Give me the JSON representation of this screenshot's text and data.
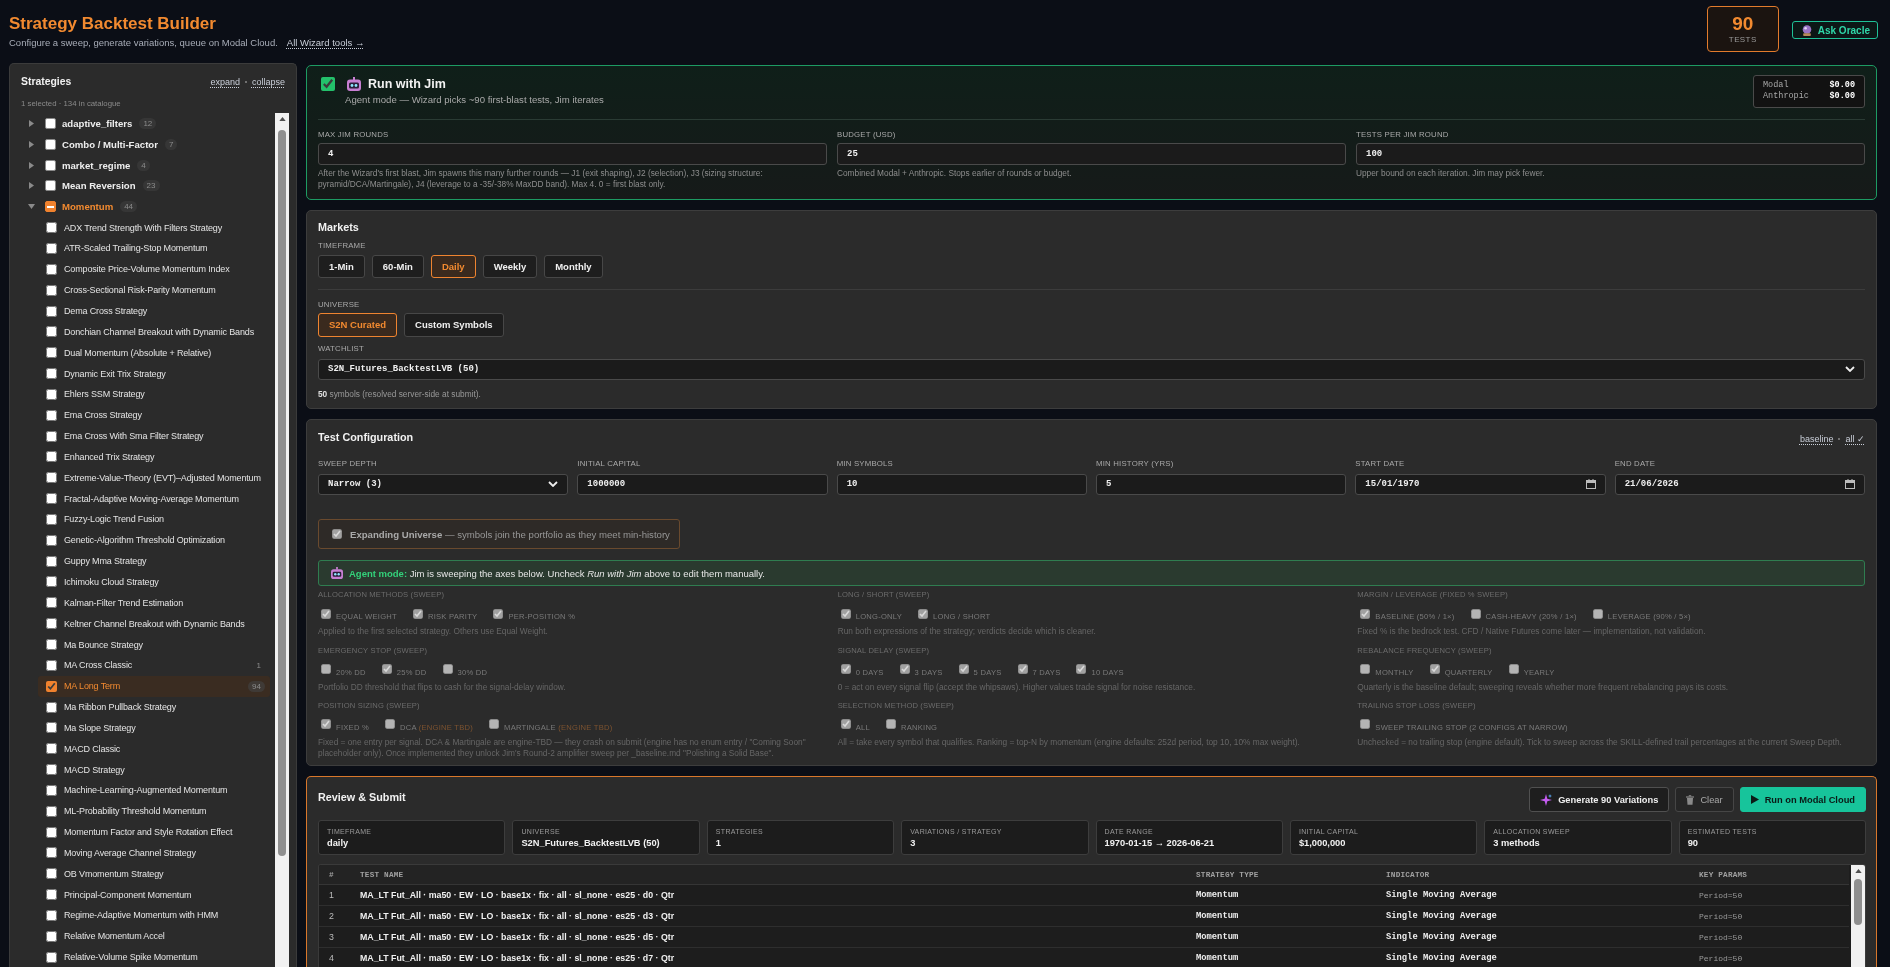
{
  "header": {
    "title": "Strategy Backtest Builder",
    "subtitle": "Configure a sweep, generate variations, queue on Modal Cloud.",
    "link": "All Wizard tools →",
    "tests_count": "90",
    "tests_label": "TESTS",
    "oracle_button": "Ask Oracle"
  },
  "sidebar": {
    "title": "Strategies",
    "actions": [
      "expand",
      "collapse"
    ],
    "summary": "1 selected · 134 in catalogue",
    "categories": [
      {
        "label": "adaptive_filters",
        "count": "12",
        "expanded": false,
        "checked": false,
        "indeterminate": false
      },
      {
        "label": "Combo / Multi-Factor",
        "count": "7",
        "expanded": false,
        "checked": false,
        "indeterminate": false
      },
      {
        "label": "market_regime",
        "count": "4",
        "expanded": false,
        "checked": false,
        "indeterminate": false
      },
      {
        "label": "Mean Reversion",
        "count": "23",
        "expanded": false,
        "checked": false,
        "indeterminate": false
      },
      {
        "label": "Momentum",
        "count": "44",
        "expanded": true,
        "checked": true,
        "indeterminate": true,
        "children": [
          {
            "label": "ADX Trend Strength With Filters Strategy",
            "checked": false,
            "selected": false
          },
          {
            "label": "ATR-Scaled Trailing-Stop Momentum",
            "checked": false,
            "selected": false
          },
          {
            "label": "Composite Price-Volume Momentum Index",
            "checked": false,
            "selected": false
          },
          {
            "label": "Cross-Sectional Risk-Parity Momentum",
            "checked": false,
            "selected": false
          },
          {
            "label": "Dema Cross Strategy",
            "checked": false,
            "selected": false
          },
          {
            "label": "Donchian Channel Breakout with Dynamic Bands",
            "checked": false,
            "selected": false
          },
          {
            "label": "Dual Momentum (Absolute + Relative)",
            "checked": false,
            "selected": false
          },
          {
            "label": "Dynamic Exit Trix Strategy",
            "checked": false,
            "selected": false
          },
          {
            "label": "Ehlers SSM Strategy",
            "checked": false,
            "selected": false
          },
          {
            "label": "Ema Cross Strategy",
            "checked": false,
            "selected": false
          },
          {
            "label": "Ema Cross With Sma Filter Strategy",
            "checked": false,
            "selected": false
          },
          {
            "label": "Enhanced Trix Strategy",
            "checked": false,
            "selected": false
          },
          {
            "label": "Extreme-Value-Theory (EVT)–Adjusted Momentum",
            "checked": false,
            "selected": false
          },
          {
            "label": "Fractal-Adaptive Moving-Average Momentum",
            "checked": false,
            "selected": false
          },
          {
            "label": "Fuzzy-Logic Trend Fusion",
            "checked": false,
            "selected": false
          },
          {
            "label": "Genetic-Algorithm Threshold Optimization",
            "checked": false,
            "selected": false
          },
          {
            "label": "Guppy Mma Strategy",
            "checked": false,
            "selected": false
          },
          {
            "label": "Ichimoku Cloud Strategy",
            "checked": false,
            "selected": false
          },
          {
            "label": "Kalman-Filter Trend Estimation",
            "checked": false,
            "selected": false
          },
          {
            "label": "Keltner Channel Breakout with Dynamic Bands",
            "checked": false,
            "selected": false
          },
          {
            "label": "Ma Bounce Strategy",
            "checked": false,
            "selected": false
          },
          {
            "label": "MA Cross Classic",
            "count": "1",
            "checked": false,
            "selected": false
          },
          {
            "label": "MA Long Term",
            "count": "94",
            "checked": true,
            "selected": true
          },
          {
            "label": "Ma Ribbon Pullback Strategy",
            "checked": false,
            "selected": false
          },
          {
            "label": "Ma Slope Strategy",
            "checked": false,
            "selected": false
          },
          {
            "label": "MACD Classic",
            "checked": false,
            "selected": false
          },
          {
            "label": "MACD Strategy",
            "checked": false,
            "selected": false
          },
          {
            "label": "Machine-Learning-Augmented Momentum",
            "checked": false,
            "selected": false
          },
          {
            "label": "ML-Probability Threshold Momentum",
            "checked": false,
            "selected": false
          },
          {
            "label": "Momentum Factor and Style Rotation Effect",
            "checked": false,
            "selected": false
          },
          {
            "label": "Moving Average Channel Strategy",
            "checked": false,
            "selected": false
          },
          {
            "label": "OB Vmomentum Strategy",
            "checked": false,
            "selected": false
          },
          {
            "label": "Principal-Component Momentum",
            "checked": false,
            "selected": false
          },
          {
            "label": "Regime-Adaptive Momentum with HMM",
            "checked": false,
            "selected": false
          },
          {
            "label": "Relative Momentum Accel",
            "checked": false,
            "selected": false
          },
          {
            "label": "Relative-Volume Spike Momentum",
            "checked": false,
            "selected": false
          }
        ]
      }
    ]
  },
  "agent": {
    "checked": true,
    "title": "Run with Jim",
    "subtitle": "Agent mode — Wizard picks ~90 first-blast tests, Jim iterates",
    "costs": [
      {
        "name": "Modal",
        "value": "$0.00"
      },
      {
        "name": "Anthropic",
        "value": "$0.00"
      }
    ],
    "fields": [
      {
        "label": "MAX JIM ROUNDS",
        "value": "4",
        "hint": "After the Wizard's first blast, Jim spawns this many further rounds — J1 (exit shaping), J2 (selection), J3 (sizing structure: pyramid/DCA/Martingale), J4 (leverage to a -35/-38% MaxDD band). Max 4. 0 = first blast only."
      },
      {
        "label": "BUDGET (USD)",
        "value": "25",
        "hint": "Combined Modal + Anthropic. Stops earlier of rounds or budget."
      },
      {
        "label": "TESTS PER JIM ROUND",
        "value": "100",
        "hint": "Upper bound on each iteration. Jim may pick fewer."
      }
    ]
  },
  "markets": {
    "title": "Markets",
    "timeframe": {
      "label": "TIMEFRAME",
      "options": [
        {
          "label": "1-Min",
          "selected": false
        },
        {
          "label": "60-Min",
          "selected": false
        },
        {
          "label": "Daily",
          "selected": true
        },
        {
          "label": "Weekly",
          "selected": false
        },
        {
          "label": "Monthly",
          "selected": false
        }
      ]
    },
    "universe": {
      "label": "UNIVERSE",
      "options": [
        {
          "label": "S2N Curated",
          "selected": true
        },
        {
          "label": "Custom Symbols",
          "selected": false
        }
      ]
    },
    "watchlist": {
      "label": "WATCHLIST",
      "value": "S2N_Futures_BacktestLVB (50)"
    },
    "note": "**50** symbols (resolved server-side at submit)."
  },
  "test_config": {
    "title": "Test Configuration",
    "presets": [
      "baseline",
      "all ✓"
    ],
    "fields": [
      {
        "kind": "select",
        "label": "SWEEP DEPTH",
        "value": "Narrow (3)"
      },
      {
        "kind": "text",
        "label": "INITIAL CAPITAL",
        "value": "1000000"
      },
      {
        "kind": "text",
        "label": "MIN SYMBOLS",
        "value": "10"
      },
      {
        "kind": "text",
        "label": "MIN HISTORY (YRS)",
        "value": "5"
      },
      {
        "kind": "date",
        "label": "START DATE",
        "value": "15/01/1970"
      },
      {
        "kind": "date",
        "label": "END DATE",
        "value": "21/06/2026"
      }
    ],
    "expanding_universe": {
      "checked": true,
      "disabled": true,
      "text": "**Expanding Universe** — symbols join the portfolio as they meet min-history"
    },
    "agent_banner": "**Agent mode:** Jim is sweeping the axes below. Uncheck *Run with Jim* above to edit them manually.",
    "sweeps": {
      "disabled": true,
      "columns": [
        {
          "groups": [
            {
              "title": "ALLOCATION METHODS (SWEEP)",
              "options": [
                {
                  "label": "EQUAL WEIGHT",
                  "checked": true
                },
                {
                  "label": "RISK PARITY",
                  "checked": true
                },
                {
                  "label": "PER-POSITION %",
                  "checked": true
                }
              ],
              "hint": "Applied to the first selected strategy. Others use Equal Weight."
            },
            {
              "title": "EMERGENCY STOP (SWEEP)",
              "options": [
                {
                  "label": "20% DD",
                  "checked": false
                },
                {
                  "label": "25% DD",
                  "checked": true
                },
                {
                  "label": "30% DD",
                  "checked": false
                }
              ],
              "hint": "Portfolio DD threshold that flips to cash for the signal-delay window."
            },
            {
              "title": "POSITION SIZING (SWEEP)",
              "options": [
                {
                  "label": "FIXED %",
                  "checked": true
                },
                {
                  "label": "DCA",
                  "tag": "(ENGINE TBD)",
                  "checked": false
                },
                {
                  "label": "MARTINGALE",
                  "tag": "(ENGINE TBD)",
                  "checked": false
                }
              ],
              "hint": "Fixed = one entry per signal. DCA & Martingale are engine-TBD — they crash on submit (engine has no enum entry / \"Coming Soon\" placeholder only). Once implemented they unlock Jim's Round-2 amplifier sweep per _baseline.md \"Polishing a Solid Base\"."
            }
          ]
        },
        {
          "groups": [
            {
              "title": "LONG / SHORT (SWEEP)",
              "options": [
                {
                  "label": "LONG-ONLY",
                  "checked": true
                },
                {
                  "label": "LONG / SHORT",
                  "checked": true
                }
              ],
              "hint": "Run both expressions of the strategy; verdicts decide which is cleaner."
            },
            {
              "title": "SIGNAL DELAY (SWEEP)",
              "options": [
                {
                  "label": "0 DAYS",
                  "checked": true
                },
                {
                  "label": "3 DAYS",
                  "checked": true
                },
                {
                  "label": "5 DAYS",
                  "checked": true
                },
                {
                  "label": "7 DAYS",
                  "checked": true
                },
                {
                  "label": "10 DAYS",
                  "checked": true
                }
              ],
              "hint": "0 = act on every signal flip (accept the whipsaws). Higher values trade signal for noise resistance."
            },
            {
              "title": "SELECTION METHOD (SWEEP)",
              "options": [
                {
                  "label": "ALL",
                  "checked": true
                },
                {
                  "label": "RANKING",
                  "checked": false
                }
              ],
              "hint": "All = take every symbol that qualifies. Ranking = top-N by momentum (engine defaults: 252d period, top 10, 10% max weight)."
            }
          ]
        },
        {
          "groups": [
            {
              "title": "MARGIN / LEVERAGE (FIXED % SWEEP)",
              "options": [
                {
                  "label": "BASELINE (50% / 1×)",
                  "checked": true
                },
                {
                  "label": "CASH-HEAVY (20% / 1×)",
                  "checked": false
                },
                {
                  "label": "LEVERAGE (90% / 5×)",
                  "checked": false
                }
              ],
              "hint": "Fixed % is the bedrock test. CFD / Native Futures come later — implementation, not validation."
            },
            {
              "title": "REBALANCE FREQUENCY (SWEEP)",
              "options": [
                {
                  "label": "MONTHLY",
                  "checked": false
                },
                {
                  "label": "QUARTERLY",
                  "checked": true
                },
                {
                  "label": "YEARLY",
                  "checked": false
                }
              ],
              "hint": "Quarterly is the baseline default; sweeping reveals whether more frequent rebalancing pays its costs."
            },
            {
              "title": "TRAILING STOP LOSS (SWEEP)",
              "options": [
                {
                  "label": "SWEEP TRAILING STOP (2 CONFIGS AT NARROW)",
                  "checked": false
                }
              ],
              "hint": "Unchecked = no trailing stop (engine default). Tick to sweep across the SKILL-defined trail percentages at the current Sweep Depth."
            }
          ]
        }
      ]
    }
  },
  "review": {
    "title": "Review & Submit",
    "buttons": [
      {
        "kind": "generate",
        "label": "Generate 90 Variations"
      },
      {
        "kind": "clear",
        "label": "Clear"
      },
      {
        "kind": "run",
        "label": "Run on Modal Cloud"
      }
    ],
    "summary": [
      {
        "label": "TIMEFRAME",
        "value": "daily"
      },
      {
        "label": "UNIVERSE",
        "value": "S2N_Futures_BacktestLVB (50)"
      },
      {
        "label": "STRATEGIES",
        "value": "1"
      },
      {
        "label": "VARIATIONS / STRATEGY",
        "value": "3"
      },
      {
        "label": "DATE RANGE",
        "value": "1970-01-15 → 2026-06-21"
      },
      {
        "label": "INITIAL CAPITAL",
        "value": "$1,000,000"
      },
      {
        "label": "ALLOCATION SWEEP",
        "value": "3 methods"
      },
      {
        "label": "ESTIMATED TESTS",
        "value": "90"
      }
    ],
    "table": {
      "columns": [
        "#",
        "TEST NAME",
        "STRATEGY TYPE",
        "INDICATOR",
        "KEY PARAMS"
      ],
      "rows": [
        [
          "1",
          "MA_LT Fut_All · ma50 · EW · LO · base1x · fix · all · sl_none · es25 · d0 · Qtr",
          "Momentum",
          "Single Moving Average",
          "Period=50"
        ],
        [
          "2",
          "MA_LT Fut_All · ma50 · EW · LO · base1x · fix · all · sl_none · es25 · d3 · Qtr",
          "Momentum",
          "Single Moving Average",
          "Period=50"
        ],
        [
          "3",
          "MA_LT Fut_All · ma50 · EW · LO · base1x · fix · all · sl_none · es25 · d5 · Qtr",
          "Momentum",
          "Single Moving Average",
          "Period=50"
        ],
        [
          "4",
          "MA_LT Fut_All · ma50 · EW · LO · base1x · fix · all · sl_none · es25 · d7 · Qtr",
          "Momentum",
          "Single Moving Average",
          "Period=50"
        ]
      ]
    }
  }
}
